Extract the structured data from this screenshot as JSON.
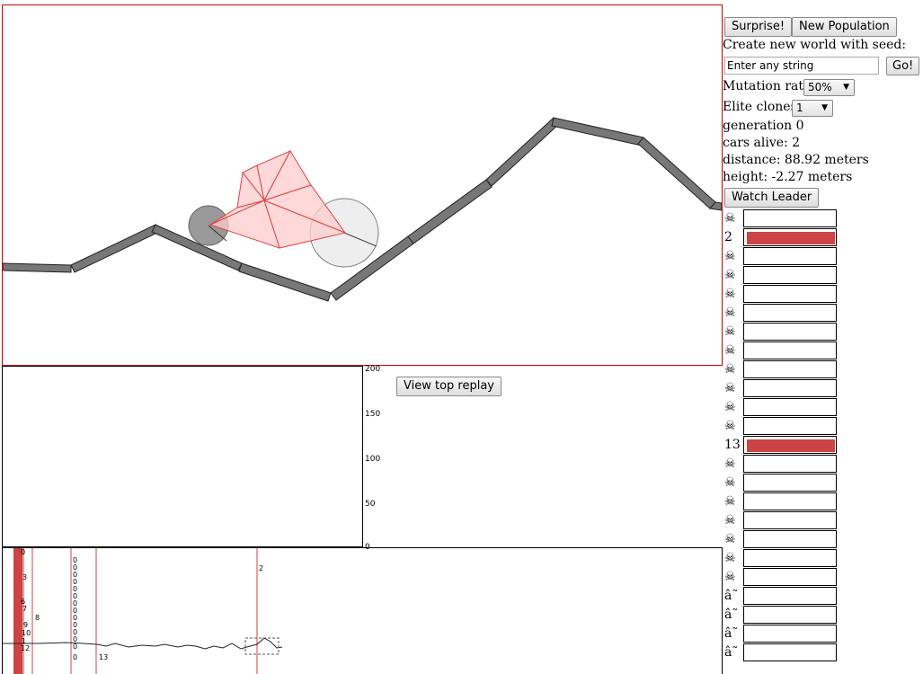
{
  "controls": {
    "surprise_label": "Surprise!",
    "new_population_label": "New Population",
    "seed_prompt": "Create new world with seed:",
    "seed_placeholder": "Enter any string",
    "go_label": "Go!",
    "mutation_label": "Mutation rate:",
    "mutation_value": "50%",
    "elite_label": "Elite clones:",
    "elite_value": "1",
    "watch_leader_label": "Watch Leader",
    "view_top_replay_label": "View top replay"
  },
  "stats": {
    "generation": "generation 0",
    "cars_alive": "cars alive: 2",
    "distance": "distance: 88.92 meters",
    "height": "height: -2.27 meters"
  },
  "graph": {
    "ticks": [
      "200",
      "150",
      "100",
      "50",
      "0"
    ]
  },
  "health_list": [
    {
      "label": "☠",
      "health": 0
    },
    {
      "label": "2",
      "health": 1
    },
    {
      "label": "☠",
      "health": 0
    },
    {
      "label": "☠",
      "health": 0
    },
    {
      "label": "☠",
      "health": 0
    },
    {
      "label": "☠",
      "health": 0
    },
    {
      "label": "☠",
      "health": 0
    },
    {
      "label": "☠",
      "health": 0
    },
    {
      "label": "☠",
      "health": 0
    },
    {
      "label": "☠",
      "health": 0
    },
    {
      "label": "☠",
      "health": 0
    },
    {
      "label": "☠",
      "health": 0
    },
    {
      "label": "13",
      "health": 1
    },
    {
      "label": "☠",
      "health": 0
    },
    {
      "label": "☠",
      "health": 0
    },
    {
      "label": "☠",
      "health": 0
    },
    {
      "label": "☠",
      "health": 0
    },
    {
      "label": "☠",
      "health": 0
    },
    {
      "label": "☠",
      "health": 0
    },
    {
      "label": "☠",
      "health": 0
    },
    {
      "label": "â˜",
      "health": 0
    },
    {
      "label": "â˜",
      "health": 0
    },
    {
      "label": "â˜",
      "health": 0
    },
    {
      "label": "â˜",
      "health": 0
    }
  ],
  "minimap": {
    "labels": [
      "0",
      "3",
      "6",
      "7",
      "8",
      "9",
      "10",
      "1",
      "12",
      "0",
      "0",
      "0",
      "0",
      "0",
      "0",
      "0",
      "0",
      "0",
      "0",
      "0",
      "0",
      "0",
      "0",
      "13",
      "2"
    ]
  },
  "colors": {
    "car_fill": "#ffcccc",
    "car_stroke": "#dd4444",
    "track": "#777777",
    "health_bar": "#cc4444",
    "frame": "#cc0000"
  }
}
